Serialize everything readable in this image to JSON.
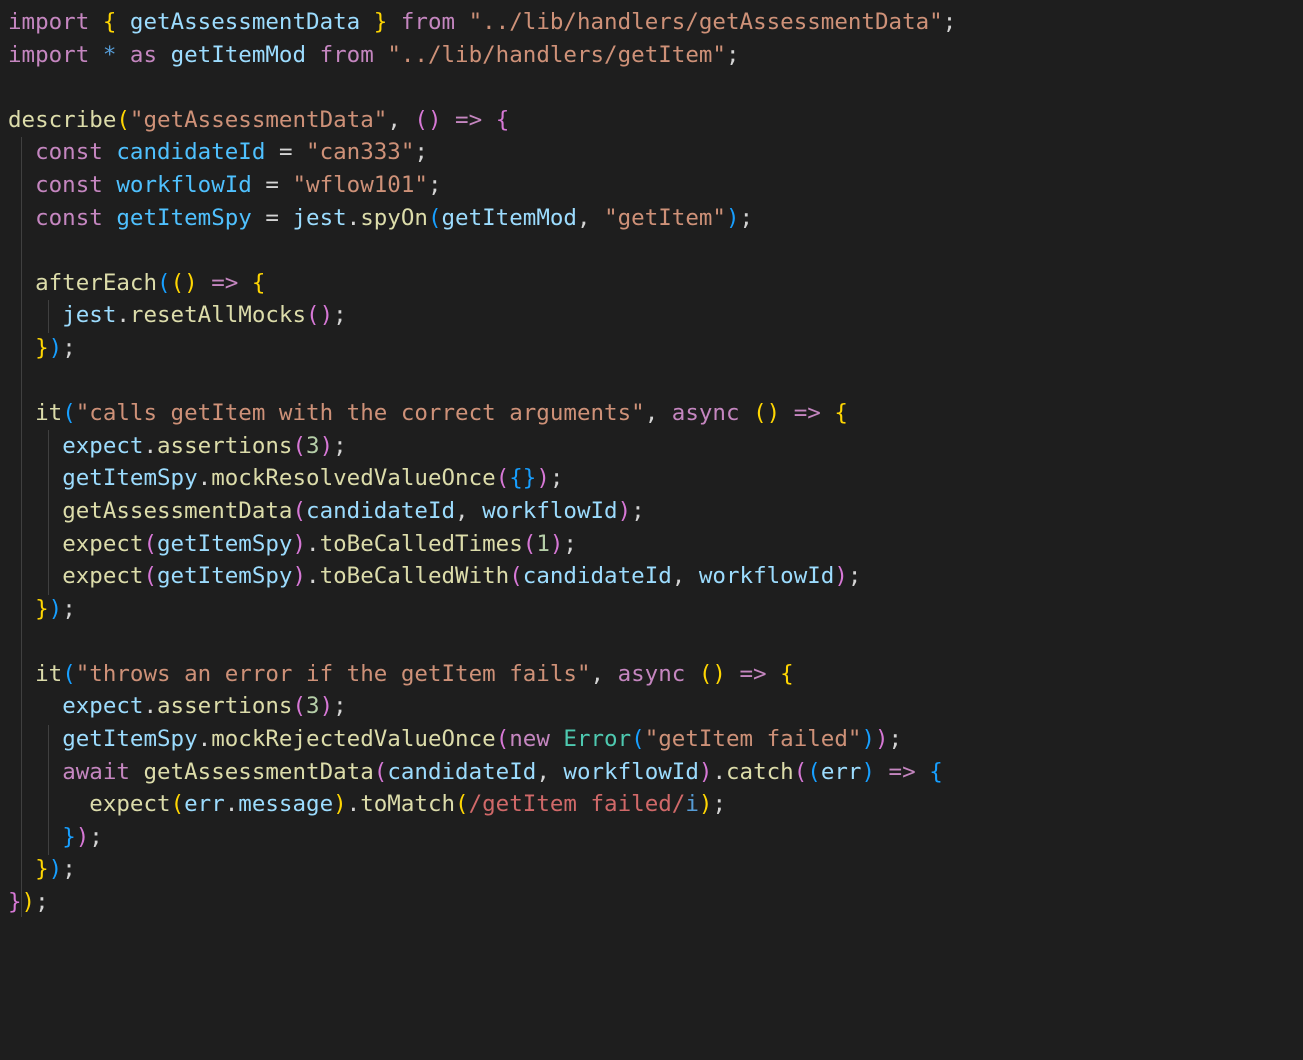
{
  "lines": {
    "l1": {
      "kw_import": "import",
      "lb": "{",
      "name": "getAssessmentData",
      "rb": "}",
      "kw_from": "from",
      "path": "\"../lib/handlers/getAssessmentData\"",
      "semi": ";"
    },
    "l2": {
      "kw_import": "import",
      "star": "*",
      "kw_as": "as",
      "alias": "getItemMod",
      "kw_from": "from",
      "path": "\"../lib/handlers/getItem\"",
      "semi": ";"
    },
    "l4": {
      "fn": "describe",
      "lp": "(",
      "arg": "\"getAssessmentData\"",
      "comma": ",",
      "alp": "(",
      "arp": ")",
      "arrow": "=>",
      "lb": "{"
    },
    "l5": {
      "kw": "const",
      "name": "candidateId",
      "eq": "=",
      "val": "\"can333\"",
      "semi": ";"
    },
    "l6": {
      "kw": "const",
      "name": "workflowId",
      "eq": "=",
      "val": "\"wflow101\"",
      "semi": ";"
    },
    "l7": {
      "kw": "const",
      "name": "getItemSpy",
      "eq": "=",
      "obj": "jest",
      "dot": ".",
      "fn": "spyOn",
      "lp": "(",
      "arg1": "getItemMod",
      "comma": ",",
      "arg2": "\"getItem\"",
      "rp": ")",
      "semi": ";"
    },
    "l9": {
      "fn": "afterEach",
      "lp": "(",
      "alp": "(",
      "arp": ")",
      "arrow": "=>",
      "lb": "{"
    },
    "l10": {
      "obj": "jest",
      "dot": ".",
      "fn": "resetAllMocks",
      "lp": "(",
      "rp": ")",
      "semi": ";"
    },
    "l11": {
      "rb": "}",
      "rp": ")",
      "semi": ";"
    },
    "l13": {
      "fn": "it",
      "lp": "(",
      "arg": "\"calls getItem with the correct arguments\"",
      "comma": ",",
      "async": "async",
      "alp": "(",
      "arp": ")",
      "arrow": "=>",
      "lb": "{"
    },
    "l14": {
      "obj": "expect",
      "dot": ".",
      "fn": "assertions",
      "lp": "(",
      "num": "3",
      "rp": ")",
      "semi": ";"
    },
    "l15": {
      "obj": "getItemSpy",
      "dot": ".",
      "fn": "mockResolvedValueOnce",
      "lp": "(",
      "lb": "{",
      "rb": "}",
      "rp": ")",
      "semi": ";"
    },
    "l16": {
      "fn": "getAssessmentData",
      "lp": "(",
      "a1": "candidateId",
      "comma": ",",
      "a2": "workflowId",
      "rp": ")",
      "semi": ";"
    },
    "l17": {
      "fn": "expect",
      "lp": "(",
      "a1": "getItemSpy",
      "rp": ")",
      "dot": ".",
      "fn2": "toBeCalledTimes",
      "lp2": "(",
      "num": "1",
      "rp2": ")",
      "semi": ";"
    },
    "l18": {
      "fn": "expect",
      "lp": "(",
      "a1": "getItemSpy",
      "rp": ")",
      "dot": ".",
      "fn2": "toBeCalledWith",
      "lp2": "(",
      "a2": "candidateId",
      "comma": ",",
      "a3": "workflowId",
      "rp2": ")",
      "semi": ";"
    },
    "l19": {
      "rb": "}",
      "rp": ")",
      "semi": ";"
    },
    "l21": {
      "fn": "it",
      "lp": "(",
      "arg": "\"throws an error if the getItem fails\"",
      "comma": ",",
      "async": "async",
      "alp": "(",
      "arp": ")",
      "arrow": "=>",
      "lb": "{"
    },
    "l22": {
      "obj": "expect",
      "dot": ".",
      "fn": "assertions",
      "lp": "(",
      "num": "3",
      "rp": ")",
      "semi": ";"
    },
    "l23": {
      "obj": "getItemSpy",
      "dot": ".",
      "fn": "mockRejectedValueOnce",
      "lp": "(",
      "kw_new": "new",
      "cls": "Error",
      "lp2": "(",
      "msg": "\"getItem failed\"",
      "rp2": ")",
      "rp": ")",
      "semi": ";"
    },
    "l24": {
      "kw_await": "await",
      "fn": "getAssessmentData",
      "lp": "(",
      "a1": "candidateId",
      "comma": ",",
      "a2": "workflowId",
      "rp": ")",
      "dot": ".",
      "fn2": "catch",
      "lp2": "(",
      "alp": "(",
      "param": "err",
      "arp": ")",
      "arrow": "=>",
      "lb": "{"
    },
    "l25": {
      "fn": "expect",
      "lp": "(",
      "obj": "err",
      "dot": ".",
      "prop": "message",
      "rp": ")",
      "dot2": ".",
      "fn2": "toMatch",
      "lp2": "(",
      "regex": "/getItem failed/",
      "flag": "i",
      "rp2": ")",
      "semi": ";"
    },
    "l26": {
      "rb": "}",
      "rp": ")",
      "semi": ";"
    },
    "l27": {
      "rb": "}",
      "rp": ")",
      "semi": ";"
    },
    "l28": {
      "rb": "}",
      "rp": ")",
      "semi": ";"
    }
  }
}
